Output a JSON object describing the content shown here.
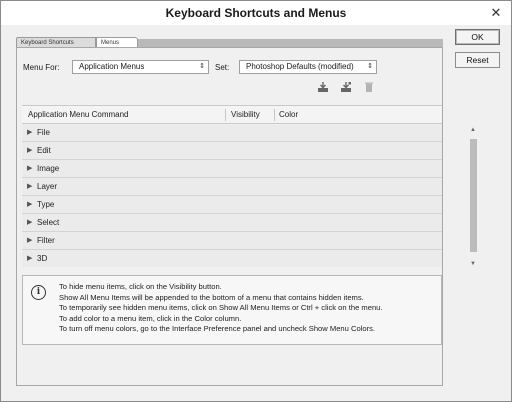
{
  "window": {
    "title": "Keyboard Shortcuts and Menus",
    "close_label": "✕"
  },
  "tabs": [
    {
      "label": "Keyboard Shortcuts"
    },
    {
      "label": "Menus"
    }
  ],
  "menu_for": {
    "label": "Menu For:",
    "value": "Application Menus"
  },
  "set": {
    "label": "Set:",
    "value": "Photoshop Defaults (modified)"
  },
  "toolbar_icons": [
    "save-set-icon",
    "save-set-as-icon",
    "delete-set-icon"
  ],
  "grid": {
    "columns": [
      "Application Menu Command",
      "Visibility",
      "Color"
    ],
    "rows": [
      "File",
      "Edit",
      "Image",
      "Layer",
      "Type",
      "Select",
      "Filter",
      "3D"
    ]
  },
  "info": {
    "lines": [
      "To hide menu items, click on the Visibility button.",
      "Show All Menu Items will be appended to the bottom of a menu that contains hidden items.",
      "To temporarily see hidden menu items, click on Show All Menu Items or Ctrl + click on the menu.",
      "To add color to a menu item, click in the Color column.",
      "To turn off menu colors, go to the Interface Preference panel and uncheck Show Menu Colors."
    ]
  },
  "buttons": {
    "ok": "OK",
    "reset": "Reset"
  }
}
